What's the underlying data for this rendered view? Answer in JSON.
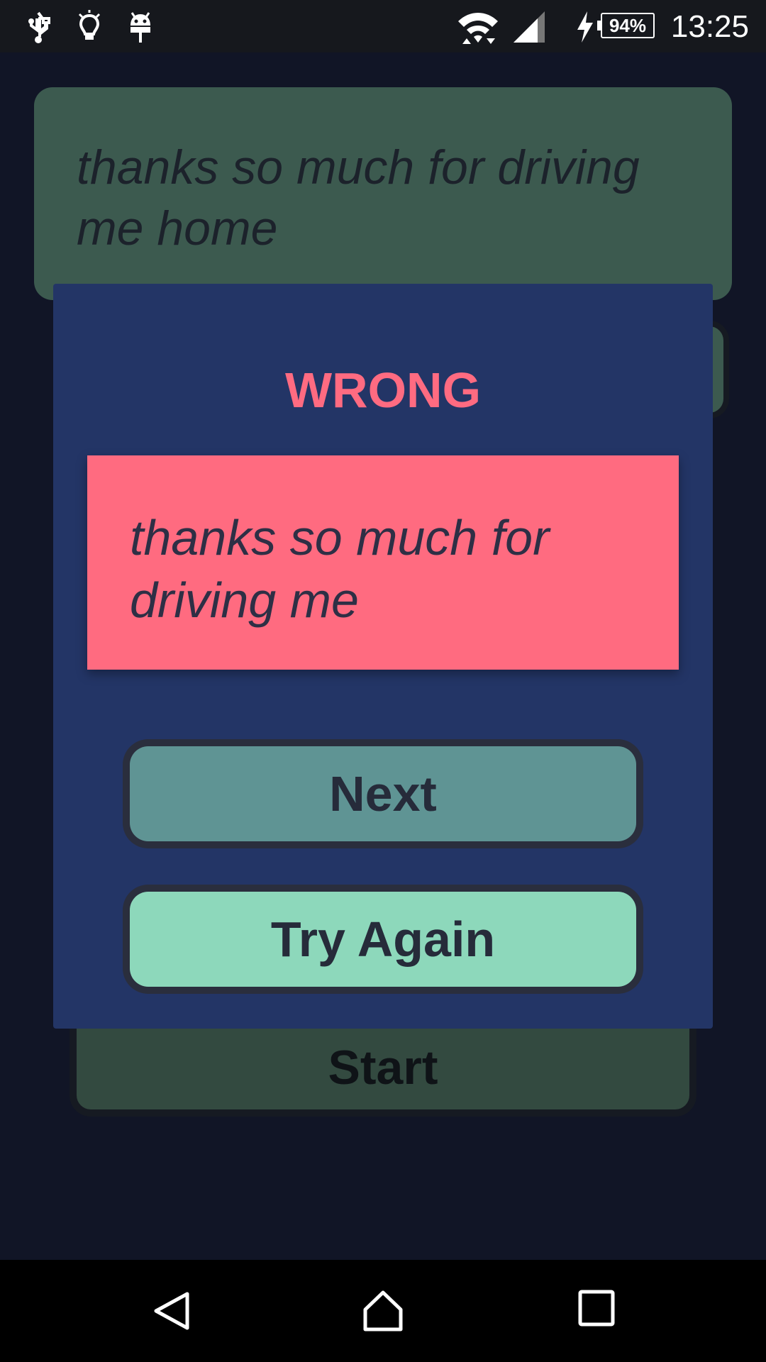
{
  "status_bar": {
    "time": "13:25",
    "battery_percent": "94%",
    "icons": [
      "usb-icon",
      "lightbulb-icon",
      "android-icon",
      "wifi-icon",
      "signal-icon",
      "charging-icon",
      "battery-icon"
    ]
  },
  "background": {
    "phrase": "thanks so much for driving me home",
    "start_label": "Start"
  },
  "dialog": {
    "title": "WRONG",
    "answer": "thanks so much for driving me",
    "next_label": "Next",
    "try_again_label": "Try Again"
  },
  "nav_bar": {
    "icons": [
      "back-icon",
      "home-icon",
      "recents-icon"
    ]
  },
  "colors": {
    "wrong": "#ff6b81",
    "dialog_bg": "#233566",
    "next_button": "#5f9494",
    "try_again_button": "#8dd8bb",
    "card_bg": "#3c5a4f"
  }
}
